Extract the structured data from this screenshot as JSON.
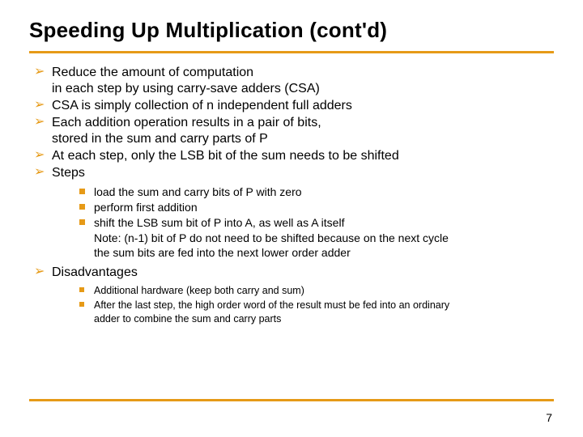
{
  "title": "Speeding Up Multiplication (cont'd)",
  "bullets": [
    {
      "text": "Reduce the amount of computation\nin each step by using carry-save adders (CSA)"
    },
    {
      "text": "CSA is simply collection of n independent full adders"
    },
    {
      "text": "Each addition operation results in a pair of bits,\nstored in the sum and carry parts of P"
    },
    {
      "text": "At each step, only the LSB bit of the sum needs to be shifted"
    },
    {
      "text": "Steps",
      "sub": [
        "load the sum and carry bits of P with zero",
        "perform first addition",
        "shift the LSB sum bit of P into A, as well as A itself\nNote: (n-1) bit of P do not need to be shifted because on the next cycle\nthe sum bits are fed into the next lower order adder"
      ]
    },
    {
      "text": "Disadvantages",
      "sub_small": [
        "Additional hardware (keep both carry and sum)",
        "After the last step, the high order word of the result must be fed into an ordinary\nadder to combine the sum and carry parts"
      ]
    }
  ],
  "page_number": "7",
  "colors": {
    "accent": "#e69a17"
  }
}
